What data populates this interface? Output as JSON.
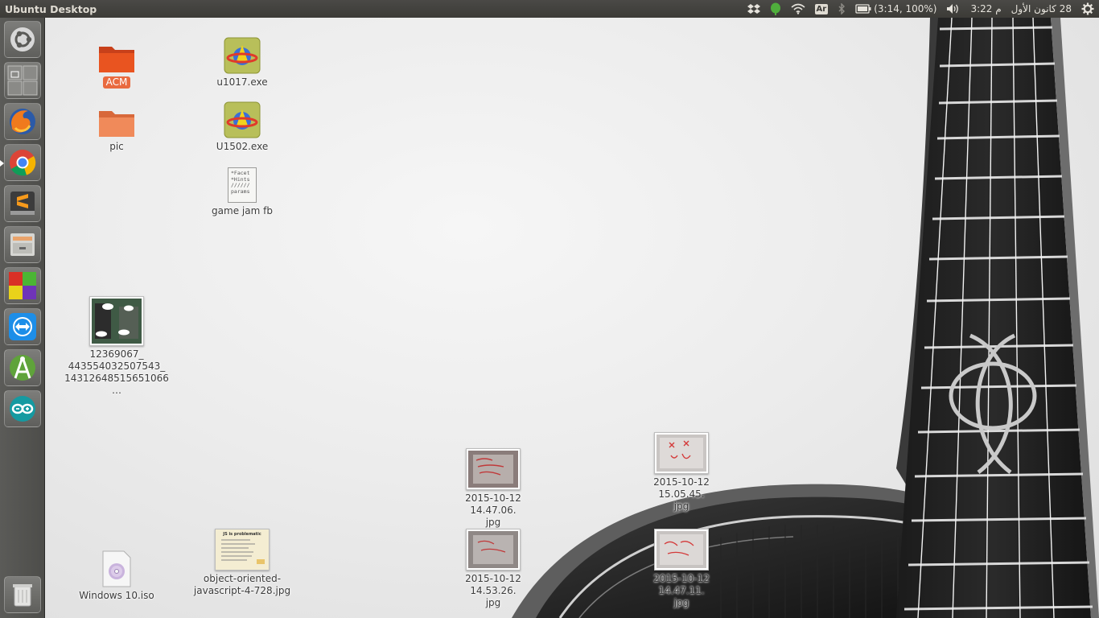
{
  "panel": {
    "title": "Ubuntu Desktop",
    "indicators": {
      "keyboard_layout": "Ar",
      "battery": "(3:14, 100%)",
      "time": "3:22 م",
      "date": "28 كانون الأول"
    }
  },
  "launcher": {
    "items": [
      {
        "name": "dash-home",
        "icon": "ubuntu-logo-icon"
      },
      {
        "name": "workspace-switcher",
        "icon": "workspace-icon"
      },
      {
        "name": "firefox",
        "icon": "firefox-icon"
      },
      {
        "name": "chrome",
        "icon": "chrome-icon",
        "active": true
      },
      {
        "name": "sublime-text",
        "icon": "sublime-icon"
      },
      {
        "name": "files-archive",
        "icon": "drawer-icon"
      },
      {
        "name": "colorful-app",
        "icon": "cubes-icon"
      },
      {
        "name": "teamviewer",
        "icon": "teamviewer-icon"
      },
      {
        "name": "android-studio",
        "icon": "android-studio-icon"
      },
      {
        "name": "arduino",
        "icon": "arduino-icon"
      },
      {
        "name": "trash",
        "icon": "trash-icon"
      }
    ]
  },
  "desktop": {
    "acm_folder": "ACM",
    "pic_folder": "pic",
    "u1017": "u1017.exe",
    "u1502": "U1502.exe",
    "game_jam": "game jam fb",
    "game_jam_preview": "*Facet\n*Hints\n//////\nparams",
    "photo_long": "12369067_\n443554032507543_\n14312648515651066…",
    "img_144706": "2015-10-12 14.47.06.\njpg",
    "img_150545": "2015-10-12 15.05.45.\njpg",
    "img_145326": "2015-10-12 14.53.26.\njpg",
    "img_144711": "2015-10-12 14.47.11.\njpg",
    "windows_iso": "Windows 10.iso",
    "oo_js": "object-oriented-\njavascript-4-728.jpg",
    "oo_js_heading": "JS is problematic"
  },
  "colors": {
    "panel_bg": "#3c3b37",
    "folder_orange": "#e95420",
    "selection": "#e96a3f",
    "launcher_bg": "#55554f"
  }
}
